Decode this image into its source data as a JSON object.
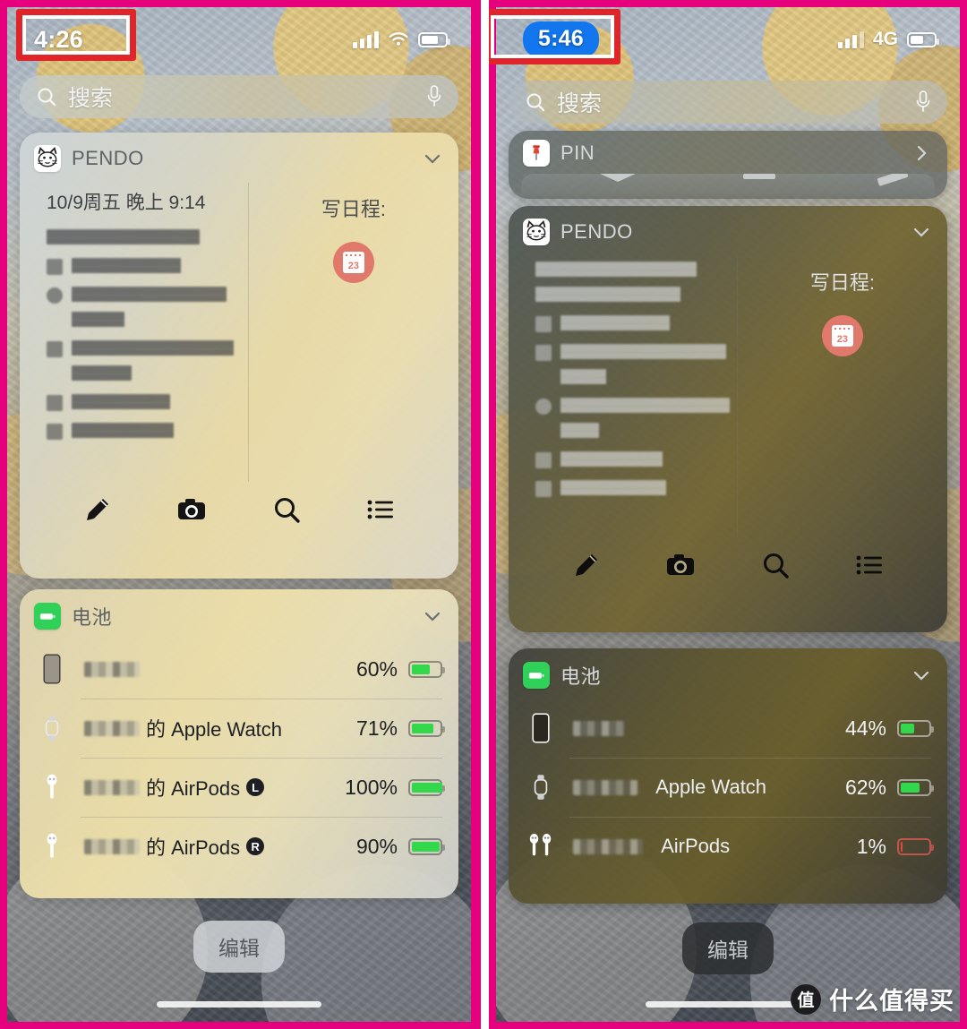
{
  "meta": {
    "accent_pink": "#e6007e",
    "annotation_red": "#e0252a",
    "battery_green": "#32d74b",
    "battery_red": "#e8453c",
    "pill_blue": "#1277ef"
  },
  "left_panel": {
    "status": {
      "time": "4:26",
      "network_label": "",
      "wifi_icon": "wifi-icon",
      "signal_icon": "signal-bars-icon",
      "battery_icon": "battery-icon",
      "battery_fill_pct": 62
    },
    "search": {
      "placeholder": "搜索",
      "search_icon": "search-icon",
      "mic_icon": "microphone-icon"
    },
    "pendo_widget": {
      "title": "PENDO",
      "app_icon": "cat-app-icon",
      "collapse_icon": "chevron-down-icon",
      "date": "10/9周五  晚上 9:14",
      "schedule_label": "写日程:",
      "calendar_icon": "calendar-23-icon",
      "censored_lines": 6,
      "toolbar": [
        {
          "icon": "pencil-icon",
          "name": "edit-note-button"
        },
        {
          "icon": "camera-icon",
          "name": "camera-button"
        },
        {
          "icon": "search-icon",
          "name": "search-button"
        },
        {
          "icon": "list-icon",
          "name": "list-button"
        }
      ]
    },
    "battery_widget": {
      "title": "电池",
      "app_icon": "battery-app-icon",
      "collapse_icon": "chevron-down-icon",
      "rows": [
        {
          "device": "iphone-icon",
          "name": "",
          "suffix": "",
          "badge": "",
          "percent": "60%",
          "fill": 60,
          "low": false
        },
        {
          "device": "watch-icon",
          "name": "",
          "suffix": "的 Apple Watch",
          "badge": "",
          "percent": "71%",
          "fill": 71,
          "low": false
        },
        {
          "device": "airpod-single-icon",
          "name": "",
          "suffix": "的 AirPods",
          "badge": "L",
          "percent": "100%",
          "fill": 100,
          "low": false
        },
        {
          "device": "airpod-single-icon",
          "name": "",
          "suffix": "的 AirPods",
          "badge": "R",
          "percent": "90%",
          "fill": 90,
          "low": false
        }
      ]
    },
    "edit_button": "编辑"
  },
  "right_panel": {
    "status": {
      "time": "5:46",
      "time_is_pill": true,
      "network_label": "4G",
      "signal_icon": "signal-bars-icon",
      "battery_icon": "battery-icon",
      "battery_fill_pct": 48
    },
    "search": {
      "placeholder": "搜索",
      "search_icon": "search-icon",
      "mic_icon": "microphone-icon"
    },
    "pin_widget": {
      "title": "PIN",
      "app_icon": "pushpin-icon",
      "chevron_icon": "chevron-right-icon"
    },
    "pendo_widget": {
      "title": "PENDO",
      "app_icon": "cat-app-icon",
      "collapse_icon": "chevron-down-icon",
      "schedule_label": "写日程:",
      "calendar_icon": "calendar-23-icon",
      "censored_lines": 7,
      "toolbar": [
        {
          "icon": "pencil-icon",
          "name": "edit-note-button"
        },
        {
          "icon": "camera-icon",
          "name": "camera-button"
        },
        {
          "icon": "search-icon",
          "name": "search-button"
        },
        {
          "icon": "list-icon",
          "name": "list-button"
        }
      ]
    },
    "battery_widget": {
      "title": "电池",
      "app_icon": "battery-app-icon",
      "collapse_icon": "chevron-down-icon",
      "rows": [
        {
          "device": "iphone-icon",
          "name": "",
          "suffix": "",
          "badge": "",
          "percent": "44%",
          "fill": 44,
          "low": false
        },
        {
          "device": "watch-icon",
          "name": "",
          "suffix": "Apple Watch",
          "badge": "",
          "percent": "62%",
          "fill": 62,
          "low": false
        },
        {
          "device": "airpods-pair-icon",
          "name": "",
          "suffix": "AirPods",
          "badge": "",
          "percent": "1%",
          "fill": 4,
          "low": true
        }
      ]
    },
    "edit_button": "编辑"
  },
  "watermark": {
    "badge": "值",
    "text": "什么值得买"
  }
}
